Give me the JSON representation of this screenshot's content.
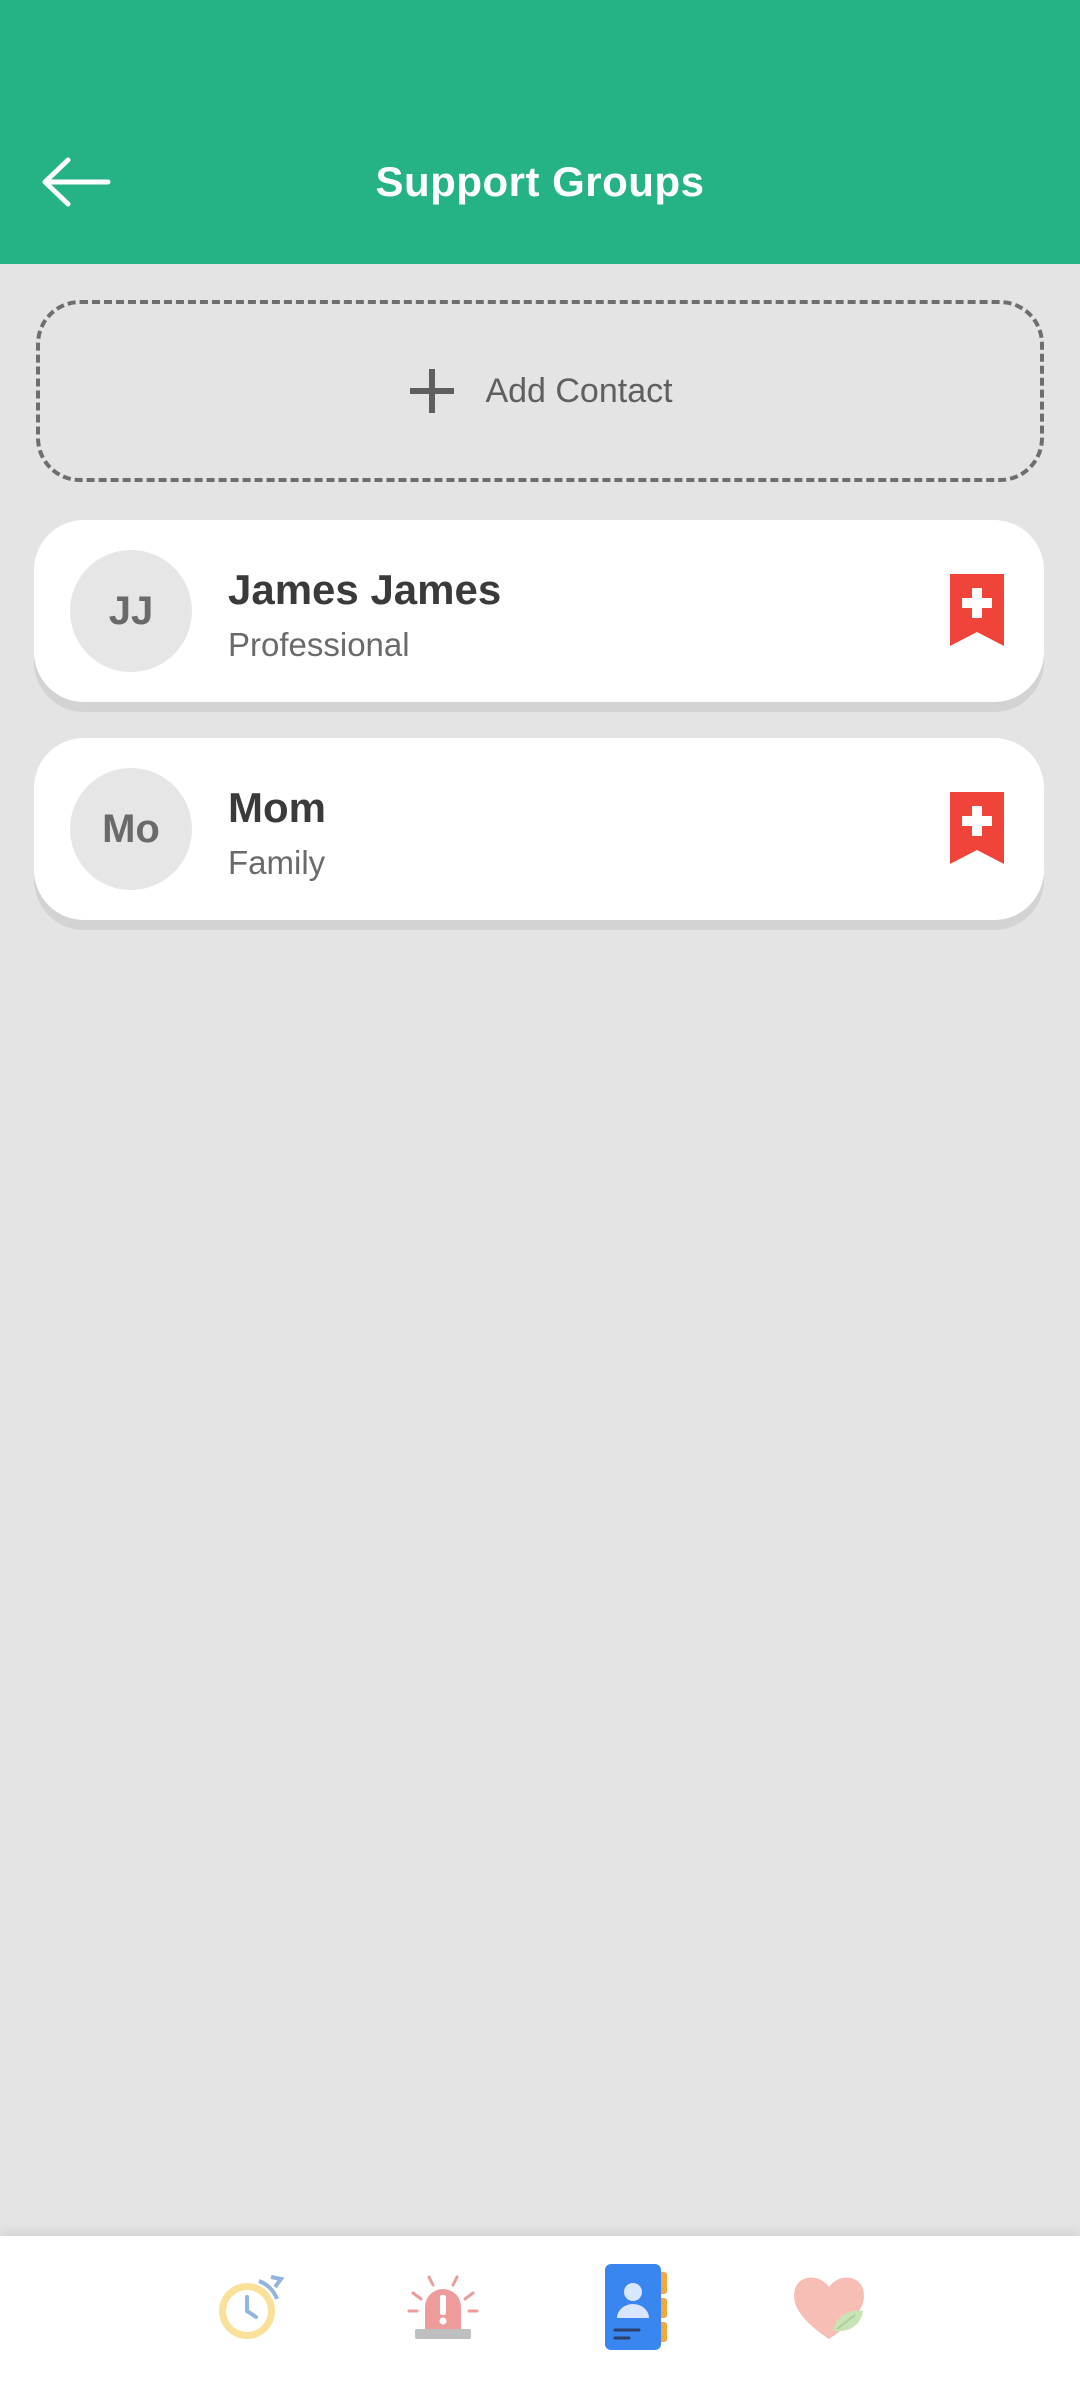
{
  "header": {
    "title": "Support Groups",
    "back_icon": "arrow-left-icon",
    "background_color": "#24b286"
  },
  "add_contact": {
    "label": "Add Contact",
    "icon": "plus-icon"
  },
  "contacts": [
    {
      "initials": "JJ",
      "name": "James James",
      "relation": "Professional",
      "flag_icon": "emergency-bookmark-icon",
      "flag_color": "#f0443a"
    },
    {
      "initials": "Mo",
      "name": "Mom",
      "relation": "Family",
      "flag_icon": "emergency-bookmark-icon",
      "flag_color": "#f0443a"
    }
  ],
  "bottom_nav": {
    "items": [
      {
        "icon": "clock-icon",
        "active": false
      },
      {
        "icon": "alarm-siren-icon",
        "active": false
      },
      {
        "icon": "contacts-book-icon",
        "active": true
      },
      {
        "icon": "heart-leaf-icon",
        "active": false
      }
    ]
  }
}
